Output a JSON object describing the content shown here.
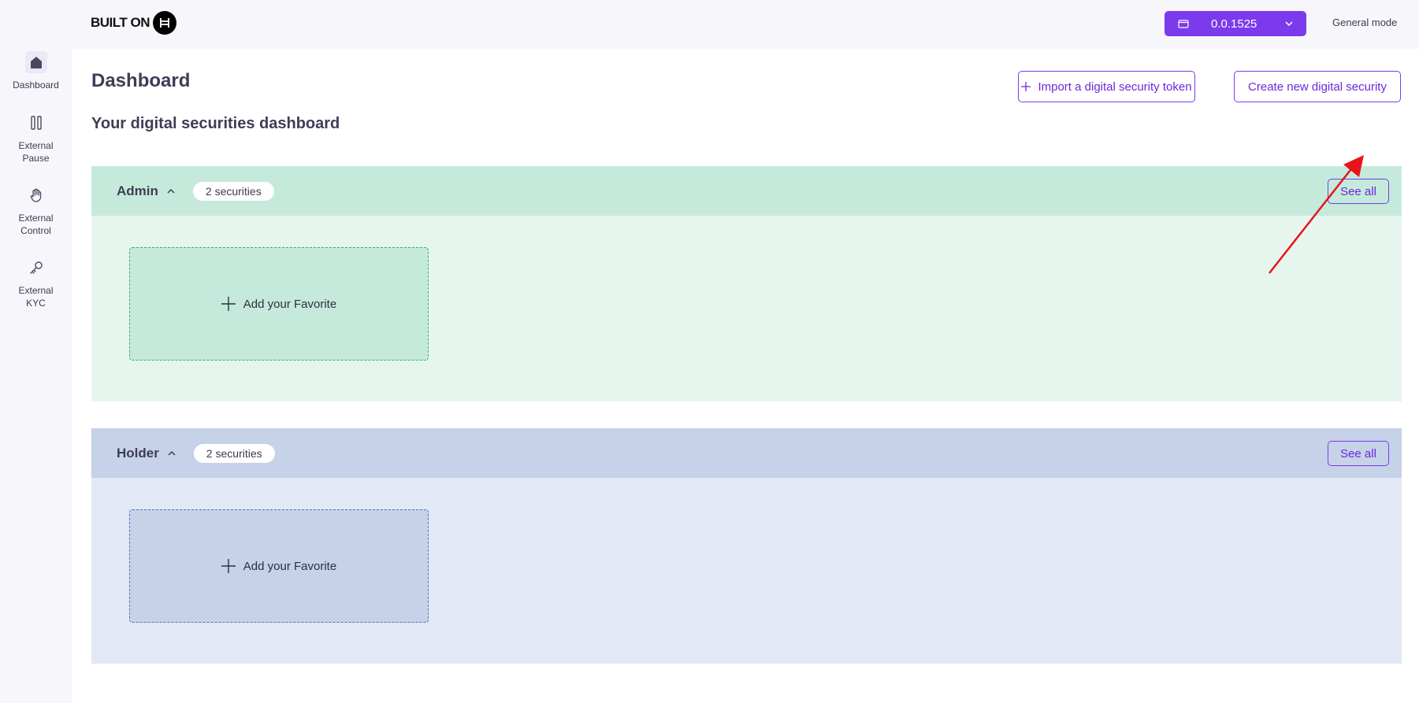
{
  "header": {
    "brand_text": "BUILT ON",
    "wallet_value": "0.0.1525",
    "mode_label": "General mode"
  },
  "sidebar": {
    "items": [
      {
        "label": "Dashboard",
        "icon": "home-icon",
        "active": true
      },
      {
        "label": "External Pause",
        "icon": "pause-icon",
        "active": false
      },
      {
        "label": "External Control",
        "icon": "hand-icon",
        "active": false
      },
      {
        "label": "External KYC",
        "icon": "key-icon",
        "active": false
      }
    ]
  },
  "main": {
    "title": "Dashboard",
    "subtitle": "Your digital securities dashboard",
    "import_button": "Import a digital security token",
    "create_button": "Create new digital security",
    "sections": [
      {
        "title": "Admin",
        "badge": "2 securities",
        "see_all": "See all",
        "favorite_label": "Add your Favorite"
      },
      {
        "title": "Holder",
        "badge": "2 securities",
        "see_all": "See all",
        "favorite_label": "Add your Favorite"
      }
    ]
  },
  "colors": {
    "accent": "#7c3aed",
    "admin_header": "#c5eadb",
    "admin_body": "#e6f6ef",
    "holder_header": "#c5d2e8",
    "holder_body": "#e2e8f4",
    "annotation_arrow": "#e8141b"
  }
}
